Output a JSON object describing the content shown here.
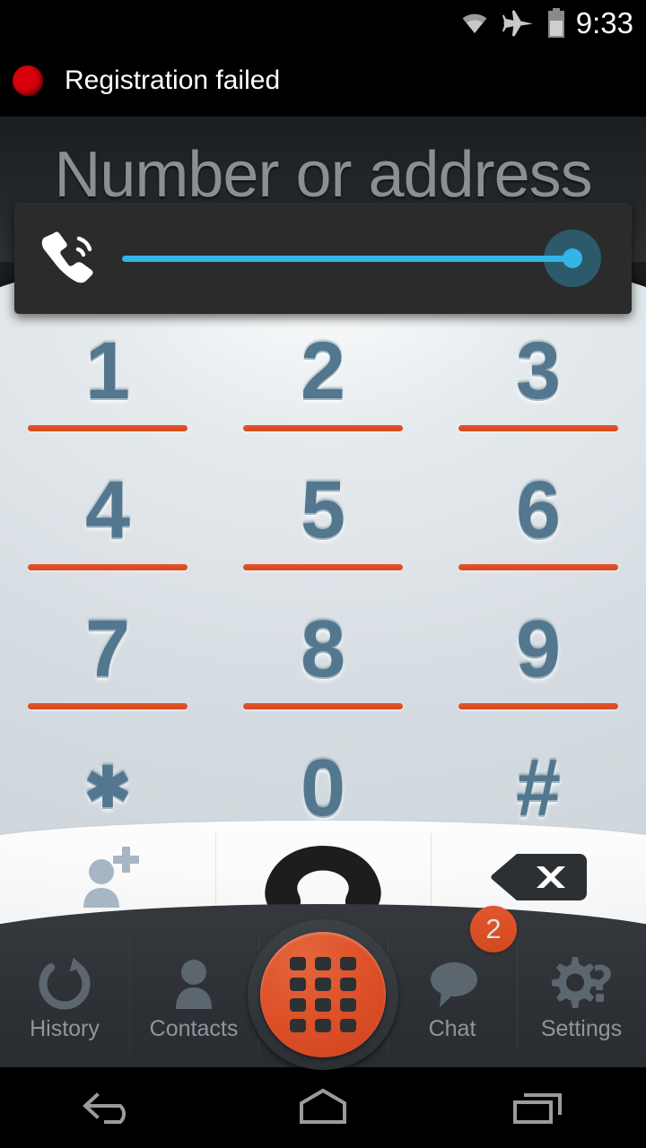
{
  "status_bar": {
    "clock": "9:33",
    "icons": [
      "wifi-icon",
      "airplane-mode-icon",
      "battery-icon"
    ]
  },
  "notification": {
    "text": "Registration failed",
    "dot_color": "#d9000c",
    "icon": "red-circle-icon"
  },
  "input": {
    "value": "",
    "placeholder": "Number or address"
  },
  "volume_overlay": {
    "icon": "ringer-volume-icon",
    "level_percent": 100,
    "accent_color": "#33b5e5",
    "panel_color": "#2b2b2b"
  },
  "dialpad": {
    "keys": [
      {
        "glyph": "1",
        "underline": true
      },
      {
        "glyph": "2",
        "underline": true
      },
      {
        "glyph": "3",
        "underline": true
      },
      {
        "glyph": "4",
        "underline": true
      },
      {
        "glyph": "5",
        "underline": true
      },
      {
        "glyph": "6",
        "underline": true
      },
      {
        "glyph": "7",
        "underline": true
      },
      {
        "glyph": "8",
        "underline": true
      },
      {
        "glyph": "9",
        "underline": true
      },
      {
        "glyph": "✱",
        "underline": false
      },
      {
        "glyph": "0",
        "underline": false
      },
      {
        "glyph": "#",
        "underline": false
      }
    ],
    "digit_color": "#52778f",
    "underline_color": "#dd4f22"
  },
  "actions": [
    {
      "name": "add-contact-button",
      "icon": "person-add-icon"
    },
    {
      "name": "call-button",
      "icon": "phone-handset-icon"
    },
    {
      "name": "backspace-button",
      "icon": "backspace-delete-icon"
    }
  ],
  "bottom_nav": {
    "items": [
      {
        "label": "History",
        "icon": "history-circular-arrow-icon"
      },
      {
        "label": "Contacts",
        "icon": "person-icon"
      },
      {
        "label": "",
        "icon": "dialpad-grid-icon"
      },
      {
        "label": "Chat",
        "icon": "speech-bubble-icon"
      },
      {
        "label": "Settings",
        "icon": "gear-question-icon"
      }
    ],
    "chat_badge": "2",
    "badge_color": "#dd4f22",
    "fab_color": "#dd4f27",
    "label_color": "#8f969c"
  },
  "system_nav": {
    "back": "back-arrow-icon",
    "home": "home-pentagon-icon",
    "recents": "recent-apps-icon"
  }
}
